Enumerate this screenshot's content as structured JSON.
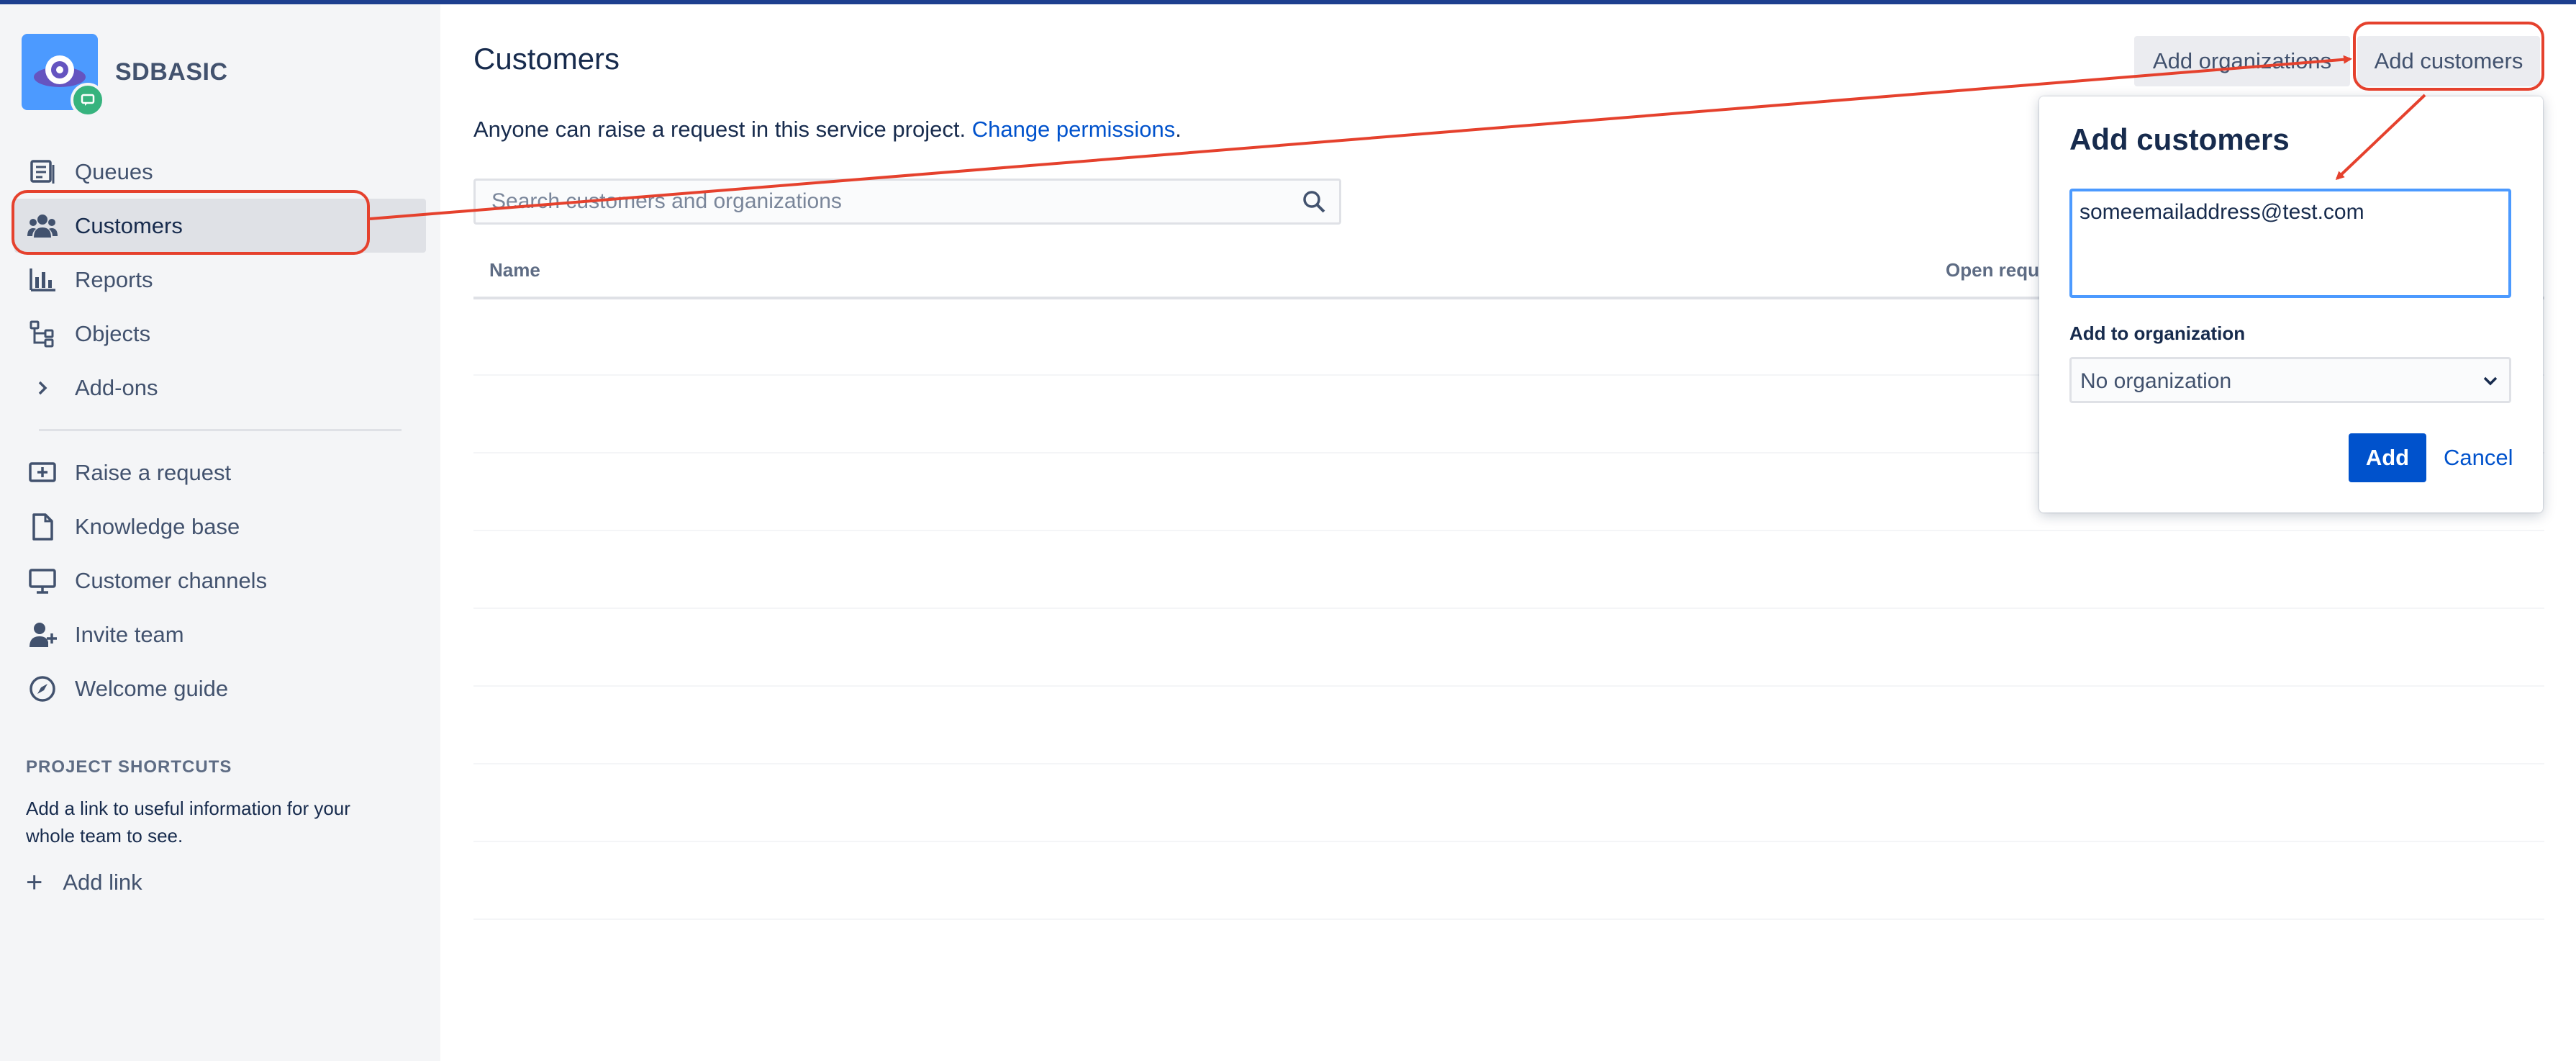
{
  "project": {
    "name": "SDBASIC"
  },
  "sidebar": {
    "items": [
      {
        "label": "Queues",
        "icon": "queues-icon"
      },
      {
        "label": "Customers",
        "icon": "customers-icon",
        "active": true
      },
      {
        "label": "Reports",
        "icon": "reports-icon"
      },
      {
        "label": "Objects",
        "icon": "objects-icon"
      },
      {
        "label": "Add-ons",
        "icon": "chevron-right-icon"
      }
    ],
    "secondary_items": [
      {
        "label": "Raise a request",
        "icon": "raise-request-icon"
      },
      {
        "label": "Knowledge base",
        "icon": "page-icon"
      },
      {
        "label": "Customer channels",
        "icon": "monitor-icon"
      },
      {
        "label": "Invite team",
        "icon": "invite-team-icon"
      },
      {
        "label": "Welcome guide",
        "icon": "compass-icon"
      }
    ],
    "shortcuts": {
      "title": "PROJECT SHORTCUTS",
      "text": "Add a link to useful information for your whole team to see.",
      "add_link": "Add link"
    }
  },
  "main": {
    "title": "Customers",
    "permissions_text": "Anyone can raise a request in this service project.",
    "permissions_link": "Change permissions",
    "permissions_suffix": ".",
    "search_placeholder": "Search customers and organizations",
    "columns": [
      "Name",
      "Open requ"
    ],
    "add_organizations_label": "Add organizations",
    "add_customers_label": "Add customers"
  },
  "dialog": {
    "title": "Add customers",
    "email_value": "someemailaddress@test.com",
    "org_label": "Add to organization",
    "org_selected": "No organization",
    "add_label": "Add",
    "cancel_label": "Cancel"
  },
  "colors": {
    "accent": "#0052cc",
    "annotation": "#e5412d",
    "sidebar_bg": "#f4f5f7",
    "focus_border": "#4c9aff",
    "topbar": "#1d3f8f"
  }
}
